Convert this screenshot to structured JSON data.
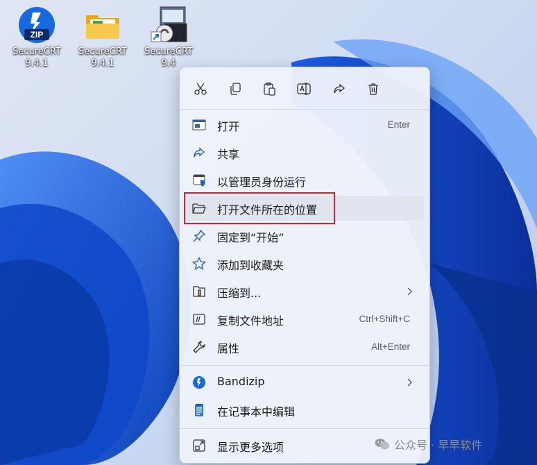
{
  "desktop_icons": [
    {
      "label_line1": "SecureCRT",
      "label_line2": "9.4.1",
      "icon": "bandizip-zip-icon"
    },
    {
      "label_line1": "SecureCRT",
      "label_line2": "9.4.1",
      "icon": "folder-icon"
    },
    {
      "label_line1": "SecureCRT",
      "label_line2": "9.4",
      "icon": "securecrt-shortcut-icon"
    }
  ],
  "context_menu": {
    "toolbar": [
      "cut-icon",
      "copy-icon",
      "paste-icon",
      "rename-icon",
      "share-icon",
      "delete-icon"
    ],
    "items": [
      {
        "label": "打开",
        "shortcut": "Enter",
        "icon": "open-app-icon"
      },
      {
        "label": "共享",
        "shortcut": "",
        "icon": "share-icon"
      },
      {
        "label": "以管理员身份运行",
        "shortcut": "",
        "icon": "admin-shield-icon"
      },
      {
        "label": "打开文件所在的位置",
        "shortcut": "",
        "icon": "folder-open-icon",
        "highlighted": true
      },
      {
        "label": "固定到“开始”",
        "shortcut": "",
        "icon": "pin-icon"
      },
      {
        "label": "添加到收藏夹",
        "shortcut": "",
        "icon": "star-icon"
      },
      {
        "label": "压缩到...",
        "shortcut": "",
        "icon": "compress-icon",
        "submenu": true
      },
      {
        "label": "复制文件地址",
        "shortcut": "Ctrl+Shift+C",
        "icon": "copy-path-icon"
      },
      {
        "label": "属性",
        "shortcut": "Alt+Enter",
        "icon": "wrench-icon"
      },
      {
        "label": "Bandizip",
        "shortcut": "",
        "icon": "bandizip-icon",
        "submenu": true
      },
      {
        "label": "在记事本中编辑",
        "shortcut": "",
        "icon": "notepad-icon"
      },
      {
        "label": "显示更多选项",
        "shortcut": "",
        "icon": "more-options-icon"
      }
    ]
  },
  "watermark": {
    "text": "公众号 · 早早软件"
  },
  "colors": {
    "highlight_border": "#d9242b",
    "accent": "#1a73e8",
    "wallpaper_blue": "#1553d6"
  }
}
